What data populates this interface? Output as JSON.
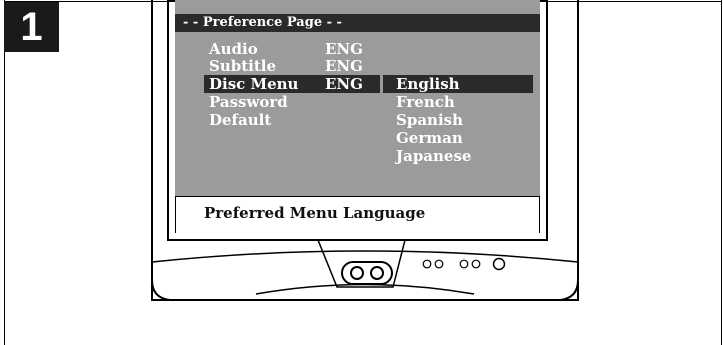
{
  "step": {
    "number": "1"
  },
  "screen": {
    "title": "- - Preference Page - -",
    "menu": [
      {
        "label": "Audio",
        "value": "ENG"
      },
      {
        "label": "Subtitle",
        "value": "ENG"
      },
      {
        "label": "Disc Menu",
        "value": "ENG"
      },
      {
        "label": "Password",
        "value": ""
      },
      {
        "label": "Default",
        "value": ""
      }
    ],
    "selected_menu_index": 2,
    "options": [
      "English",
      "French",
      "Spanish",
      "German",
      "Japanese"
    ],
    "selected_option_index": 0,
    "status": "Preferred Menu Language"
  },
  "colors": {
    "screen_bg": "#9b9b9b",
    "highlight": "#2a2a2a",
    "text_on_screen": "#ffffff"
  }
}
